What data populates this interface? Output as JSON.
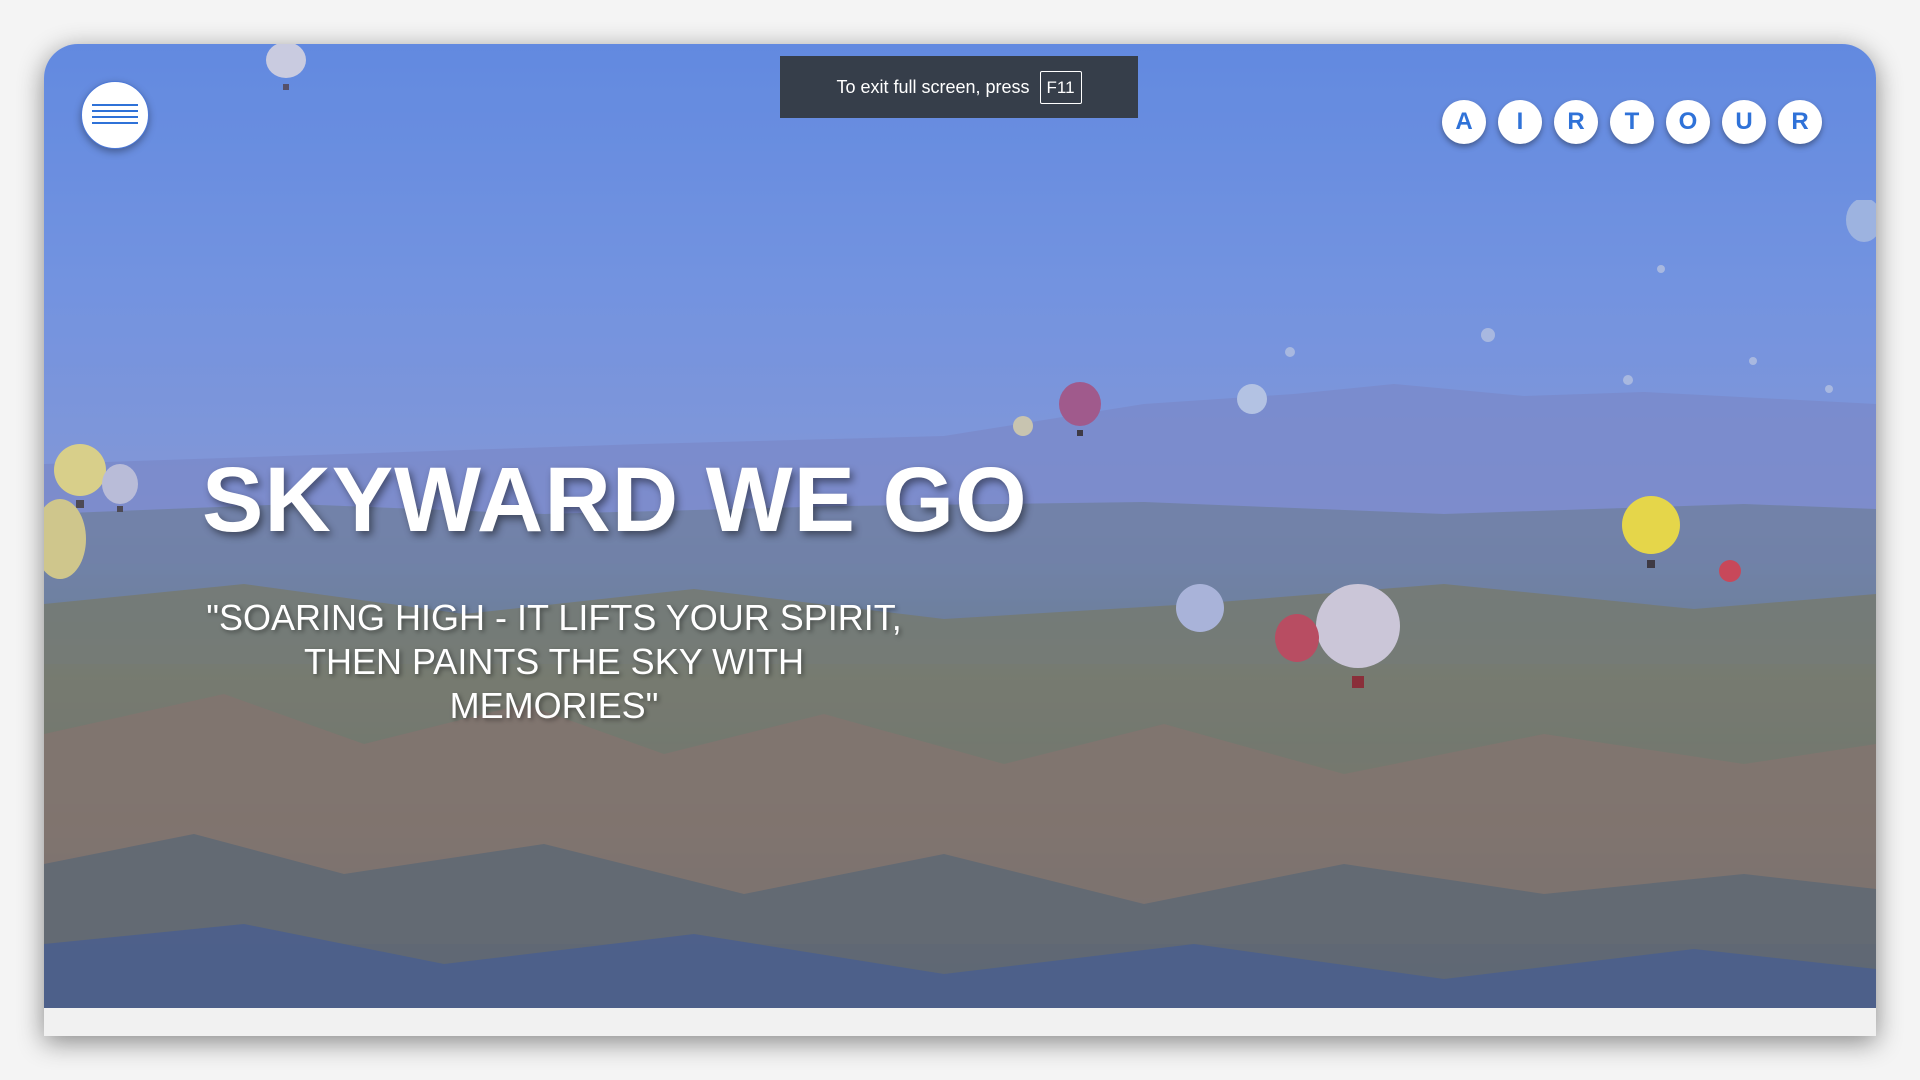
{
  "colors": {
    "accent": "#2f72d8",
    "toast_bg": "#363e4a",
    "page_bg": "#f4f4f4"
  },
  "fullscreen_toast": {
    "text": "To exit full screen, press",
    "key": "F11"
  },
  "menu": {
    "icon": "hamburger-menu-icon"
  },
  "brand": {
    "letters": [
      "A",
      "I",
      "R",
      "T",
      "O",
      "U",
      "R"
    ]
  },
  "hero": {
    "headline": "SKYWARD WE GO",
    "tagline": "\"SOARING HIGH - IT LIFTS YOUR SPIRIT, THEN PAINTS THE SKY WITH MEMORIES\""
  }
}
